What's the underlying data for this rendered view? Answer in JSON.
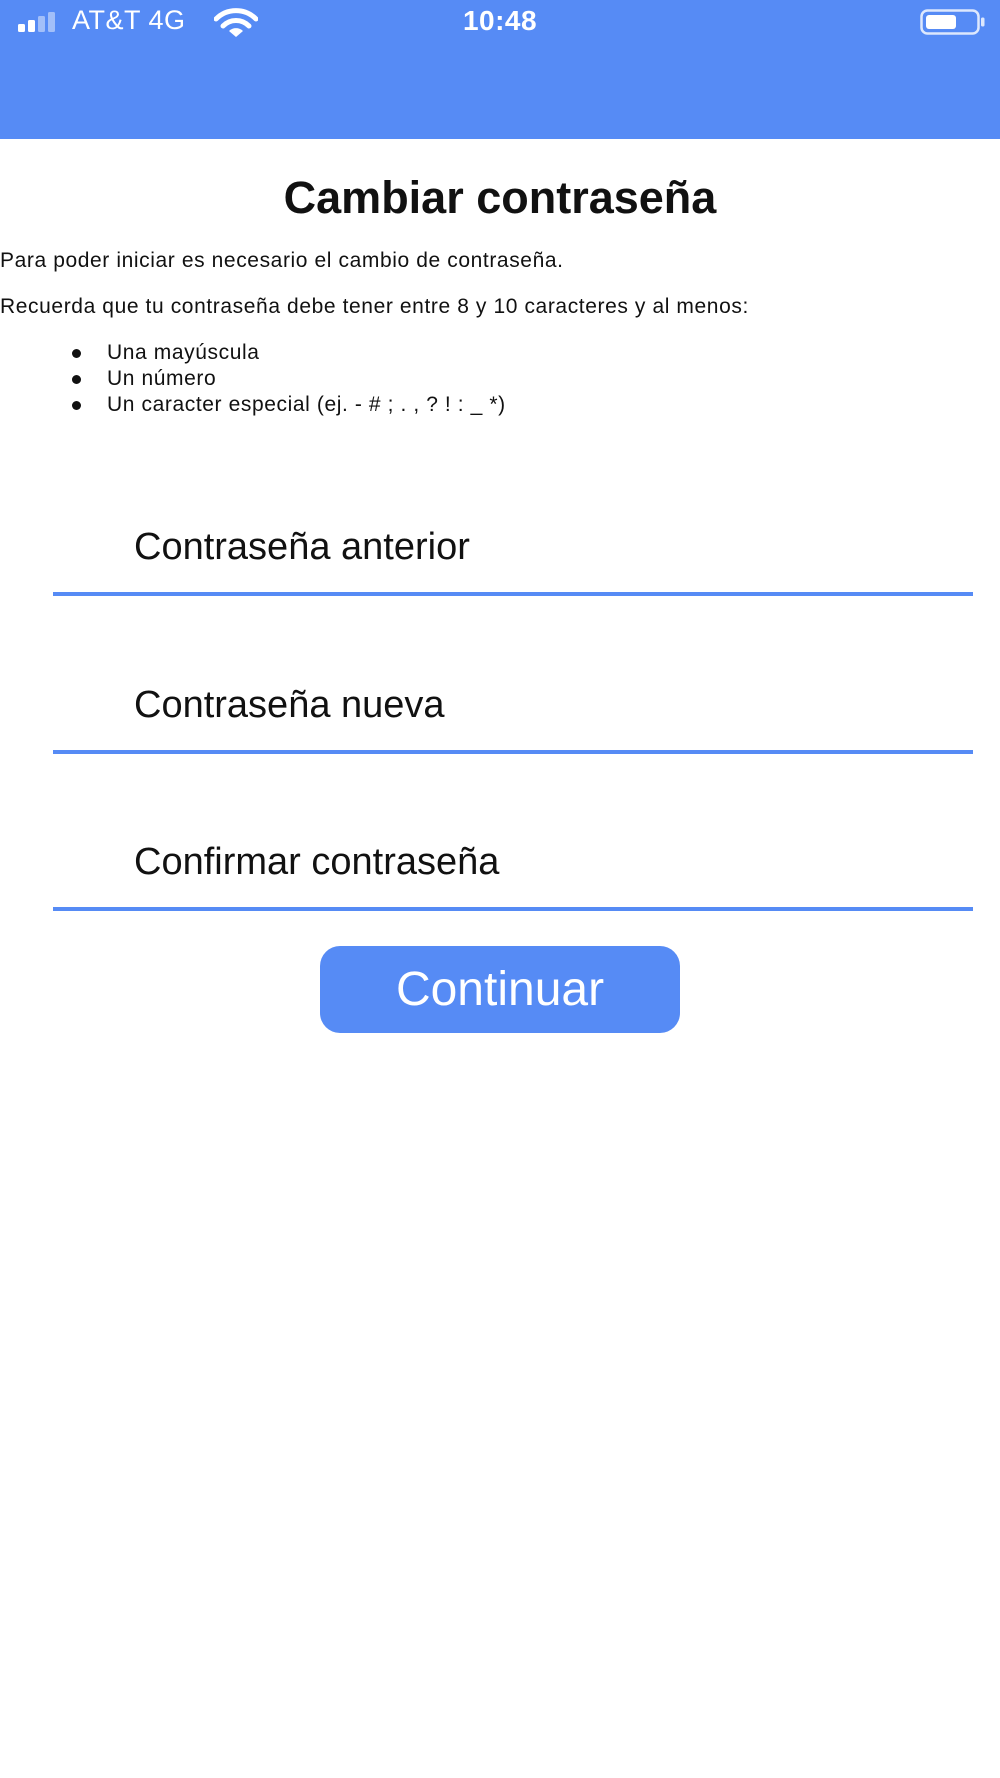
{
  "status_bar": {
    "carrier": "AT&T 4G",
    "time": "10:48",
    "icons": [
      "signal-icon",
      "wifi-icon",
      "battery-icon"
    ]
  },
  "page": {
    "title": "Cambiar contraseña",
    "intro": "Para poder iniciar es necesario el cambio de contraseña.",
    "reminder": "Recuerda que tu contraseña debe tener entre 8 y 10 caracteres y al menos:",
    "requirements": [
      "Una mayúscula",
      "Un número",
      "Un caracter especial (ej. - # ; . , ? ! : _ *)"
    ]
  },
  "form": {
    "old_password_placeholder": "Contraseña anterior",
    "new_password_placeholder": "Contraseña nueva",
    "confirm_password_placeholder": "Confirmar contraseña",
    "continue_label": "Continuar"
  },
  "colors": {
    "accent": "#568bf5",
    "text": "#111111",
    "background": "#ffffff"
  }
}
